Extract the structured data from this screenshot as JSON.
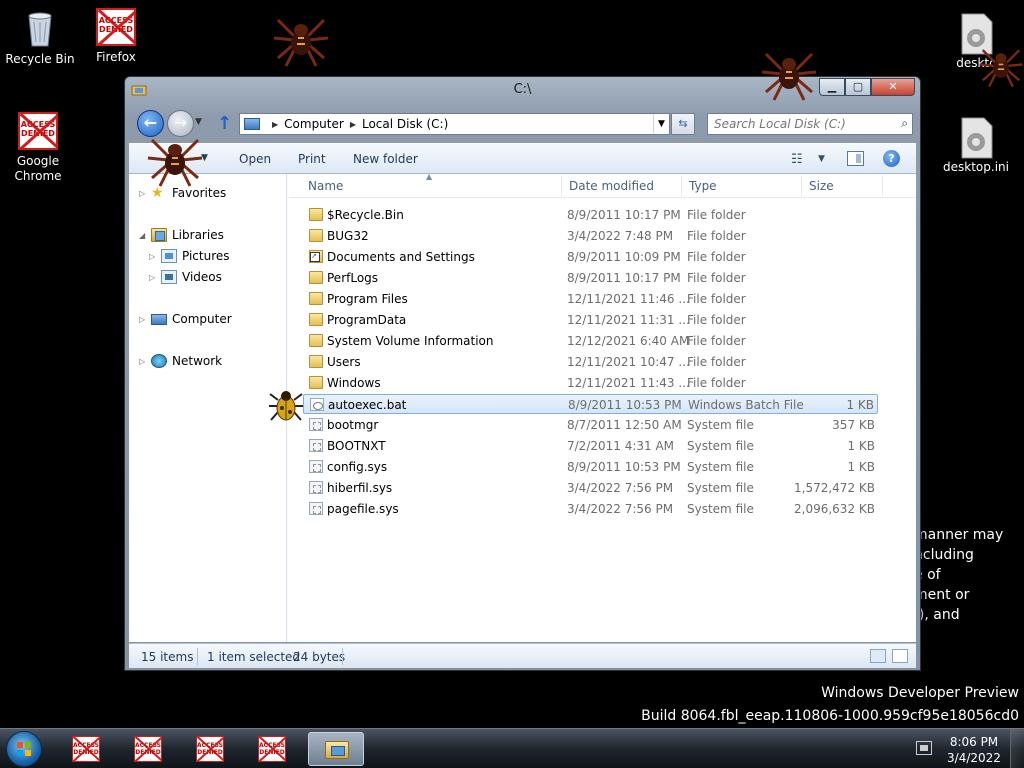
{
  "desktop": {
    "icons": [
      {
        "label": "Recycle Bin",
        "icon": "recycle-bin-icon"
      },
      {
        "label": "Firefox",
        "icon": "access-denied-icon",
        "badge": "ACCESS DENIED"
      },
      {
        "label": "Google Chrome",
        "icon": "access-denied-icon",
        "badge": "ACCESS DENIED"
      },
      {
        "label": "desktop.ini",
        "icon": "settings-file-icon"
      },
      {
        "label": "desktop.ini",
        "icon": "settings-file-icon"
      }
    ],
    "right_icon_top_label": "desktc",
    "background_text": [
      "manner may",
      "ncluding",
      "e of",
      "ment or",
      "f), and"
    ],
    "watermark": {
      "line1": "Windows Developer Preview",
      "line2": "Build 8064.fbl_eeap.110806-1000.959cf95e18056cd0"
    }
  },
  "window": {
    "title": "C:\\",
    "address": {
      "root": "Computer",
      "current": "Local Disk (C:)"
    },
    "search_placeholder": "Search Local Disk (C:)",
    "toolbar": {
      "open": "Open",
      "print": "Print",
      "new_folder": "New folder"
    },
    "nav_tree": {
      "favorites": "Favorites",
      "libraries": "Libraries",
      "pictures": "Pictures",
      "videos": "Videos",
      "computer": "Computer",
      "network": "Network"
    },
    "columns": {
      "name": "Name",
      "date": "Date modified",
      "type": "Type",
      "size": "Size"
    },
    "files": [
      {
        "name": "$Recycle.Bin",
        "date": "8/9/2011 10:17 PM",
        "type": "File folder",
        "size": "",
        "kind": "folder"
      },
      {
        "name": "BUG32",
        "date": "3/4/2022 7:48 PM",
        "type": "File folder",
        "size": "",
        "kind": "folder"
      },
      {
        "name": "Documents and Settings",
        "date": "8/9/2011 10:09 PM",
        "type": "File folder",
        "size": "",
        "kind": "shortcutf"
      },
      {
        "name": "PerfLogs",
        "date": "8/9/2011 10:17 PM",
        "type": "File folder",
        "size": "",
        "kind": "folder"
      },
      {
        "name": "Program Files",
        "date": "12/11/2021 11:46 ...",
        "type": "File folder",
        "size": "",
        "kind": "folder"
      },
      {
        "name": "ProgramData",
        "date": "12/11/2021 11:31 ...",
        "type": "File folder",
        "size": "",
        "kind": "folder"
      },
      {
        "name": "System Volume Information",
        "date": "12/12/2021 6:40 AM",
        "type": "File folder",
        "size": "",
        "kind": "folder"
      },
      {
        "name": "Users",
        "date": "12/11/2021 10:47 ...",
        "type": "File folder",
        "size": "",
        "kind": "folder"
      },
      {
        "name": "Windows",
        "date": "12/11/2021 11:43 ...",
        "type": "File folder",
        "size": "",
        "kind": "folder"
      },
      {
        "name": "autoexec.bat",
        "date": "8/9/2011 10:53 PM",
        "type": "Windows Batch File",
        "size": "1 KB",
        "kind": "bat",
        "selected": true
      },
      {
        "name": "bootmgr",
        "date": "8/7/2011 12:50 AM",
        "type": "System file",
        "size": "357 KB",
        "kind": "sysf"
      },
      {
        "name": "BOOTNXT",
        "date": "7/2/2011 4:31 AM",
        "type": "System file",
        "size": "1 KB",
        "kind": "sysf"
      },
      {
        "name": "config.sys",
        "date": "8/9/2011 10:53 PM",
        "type": "System file",
        "size": "1 KB",
        "kind": "sysf"
      },
      {
        "name": "hiberfil.sys",
        "date": "3/4/2022 7:56 PM",
        "type": "System file",
        "size": "1,572,472 KB",
        "kind": "sysf"
      },
      {
        "name": "pagefile.sys",
        "date": "3/4/2022 7:56 PM",
        "type": "System file",
        "size": "2,096,632 KB",
        "kind": "sysf"
      }
    ],
    "status": {
      "count": "15 items",
      "selected": "1 item selected",
      "bytes": "24 bytes"
    }
  },
  "taskbar": {
    "denied_badge": "ACCESS DENIED",
    "time": "8:06 PM",
    "date": "3/4/2022"
  },
  "colors": {
    "selection_border": "#84acdd",
    "denied_red": "#d21b1b",
    "toolbar_text": "#1e395b"
  }
}
